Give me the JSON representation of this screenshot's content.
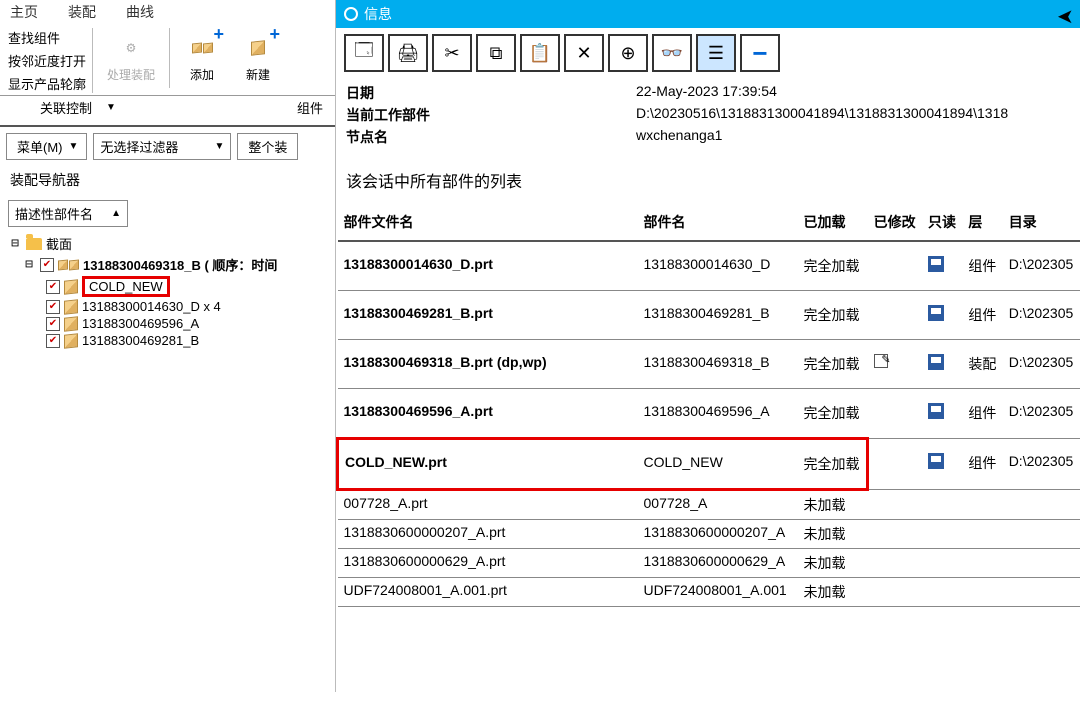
{
  "tabs": [
    "主页",
    "装配",
    "",
    "曲线"
  ],
  "ribbon_left": {
    "find": "查找组件",
    "neighbor": "按邻近度打开",
    "show_outline": "显示产品轮廓",
    "process": "处理装配"
  },
  "ribbon": {
    "add": "添加",
    "new": "新建",
    "relation": "关联控制",
    "group_right": "组件"
  },
  "menu_btn": "菜单(M)",
  "filter_select": "无选择过滤器",
  "whole_btn": "整个装",
  "left_panel": {
    "title": "装配导航器",
    "desc": "描述性部件名"
  },
  "tree": {
    "root": "截面",
    "items": [
      {
        "label": "13188300469318_B ( 顺序：时间",
        "bold": true,
        "asm": true
      },
      {
        "label": "COLD_NEW",
        "highlight": true
      },
      {
        "label": "13188300014630_D x 4"
      },
      {
        "label": "13188300469596_A"
      },
      {
        "label": "13188300469281_B"
      }
    ]
  },
  "info": {
    "title": "信息"
  },
  "info_rows": {
    "date_lbl": "日期",
    "date_val": "22-May-2023 17:39:54",
    "wp_lbl": "当前工作部件",
    "wp_val": "D:\\20230516\\1318831300041894\\1318831300041894\\1318",
    "node_lbl": "节点名",
    "node_val": "wxchenanga1"
  },
  "list_title": "该会话中所有部件的列表",
  "cols": {
    "filename": "部件文件名",
    "name": "部件名",
    "loaded": "已加载",
    "modified": "已修改",
    "readonly": "只读",
    "layer": "层",
    "dir": "目录"
  },
  "rows": [
    {
      "f": "13188300014630_D.prt",
      "n": "13188300014630_D",
      "l": "完全加载",
      "s": true,
      "lay": "组件",
      "d": "D:\\202305"
    },
    {
      "f": "13188300469281_B.prt",
      "n": "13188300469281_B",
      "l": "完全加载",
      "s": true,
      "lay": "组件",
      "d": "D:\\202305"
    },
    {
      "f": "13188300469318_B.prt (dp,wp)",
      "n": "13188300469318_B",
      "l": "完全加载",
      "e": true,
      "s": true,
      "lay": "装配",
      "d": "D:\\202305"
    },
    {
      "f": "13188300469596_A.prt",
      "n": "13188300469596_A",
      "l": "完全加载",
      "s": true,
      "lay": "组件",
      "d": "D:\\202305"
    },
    {
      "f": "COLD_NEW.prt",
      "n": "COLD_NEW",
      "l": "完全加载",
      "s": true,
      "lay": "组件",
      "d": "D:\\202305",
      "hl": true
    },
    {
      "f": "007728_A.prt",
      "n": "007728_A",
      "l": "未加载",
      "compact": true
    },
    {
      "f": "1318830600000207_A.prt",
      "n": "1318830600000207_A",
      "l": "未加载",
      "compact": true
    },
    {
      "f": "1318830600000629_A.prt",
      "n": "1318830600000629_A",
      "l": "未加载",
      "compact": true
    },
    {
      "f": "UDF724008001_A.001.prt",
      "n": "UDF724008001_A.001",
      "l": "未加载",
      "compact": true
    }
  ]
}
